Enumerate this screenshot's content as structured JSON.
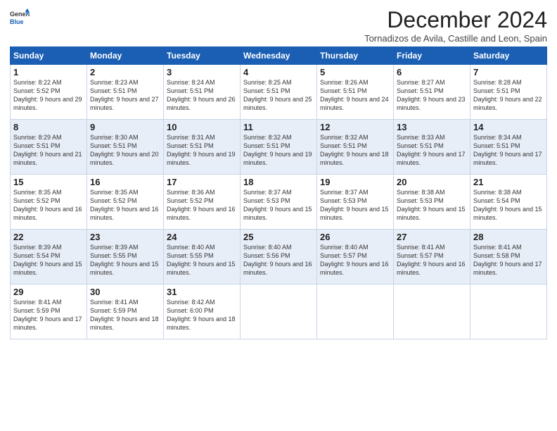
{
  "header": {
    "logo_general": "General",
    "logo_blue": "Blue",
    "title": "December 2024",
    "location": "Tornadizos de Avila, Castille and Leon, Spain"
  },
  "days_of_week": [
    "Sunday",
    "Monday",
    "Tuesday",
    "Wednesday",
    "Thursday",
    "Friday",
    "Saturday"
  ],
  "weeks": [
    [
      {
        "day": "1",
        "sunrise": "8:22 AM",
        "sunset": "5:52 PM",
        "daylight": "9 hours and 29 minutes."
      },
      {
        "day": "2",
        "sunrise": "8:23 AM",
        "sunset": "5:51 PM",
        "daylight": "9 hours and 27 minutes."
      },
      {
        "day": "3",
        "sunrise": "8:24 AM",
        "sunset": "5:51 PM",
        "daylight": "9 hours and 26 minutes."
      },
      {
        "day": "4",
        "sunrise": "8:25 AM",
        "sunset": "5:51 PM",
        "daylight": "9 hours and 25 minutes."
      },
      {
        "day": "5",
        "sunrise": "8:26 AM",
        "sunset": "5:51 PM",
        "daylight": "9 hours and 24 minutes."
      },
      {
        "day": "6",
        "sunrise": "8:27 AM",
        "sunset": "5:51 PM",
        "daylight": "9 hours and 23 minutes."
      },
      {
        "day": "7",
        "sunrise": "8:28 AM",
        "sunset": "5:51 PM",
        "daylight": "9 hours and 22 minutes."
      }
    ],
    [
      {
        "day": "8",
        "sunrise": "8:29 AM",
        "sunset": "5:51 PM",
        "daylight": "9 hours and 21 minutes."
      },
      {
        "day": "9",
        "sunrise": "8:30 AM",
        "sunset": "5:51 PM",
        "daylight": "9 hours and 20 minutes."
      },
      {
        "day": "10",
        "sunrise": "8:31 AM",
        "sunset": "5:51 PM",
        "daylight": "9 hours and 19 minutes."
      },
      {
        "day": "11",
        "sunrise": "8:32 AM",
        "sunset": "5:51 PM",
        "daylight": "9 hours and 19 minutes."
      },
      {
        "day": "12",
        "sunrise": "8:32 AM",
        "sunset": "5:51 PM",
        "daylight": "9 hours and 18 minutes."
      },
      {
        "day": "13",
        "sunrise": "8:33 AM",
        "sunset": "5:51 PM",
        "daylight": "9 hours and 17 minutes."
      },
      {
        "day": "14",
        "sunrise": "8:34 AM",
        "sunset": "5:51 PM",
        "daylight": "9 hours and 17 minutes."
      }
    ],
    [
      {
        "day": "15",
        "sunrise": "8:35 AM",
        "sunset": "5:52 PM",
        "daylight": "9 hours and 16 minutes."
      },
      {
        "day": "16",
        "sunrise": "8:35 AM",
        "sunset": "5:52 PM",
        "daylight": "9 hours and 16 minutes."
      },
      {
        "day": "17",
        "sunrise": "8:36 AM",
        "sunset": "5:52 PM",
        "daylight": "9 hours and 16 minutes."
      },
      {
        "day": "18",
        "sunrise": "8:37 AM",
        "sunset": "5:53 PM",
        "daylight": "9 hours and 15 minutes."
      },
      {
        "day": "19",
        "sunrise": "8:37 AM",
        "sunset": "5:53 PM",
        "daylight": "9 hours and 15 minutes."
      },
      {
        "day": "20",
        "sunrise": "8:38 AM",
        "sunset": "5:53 PM",
        "daylight": "9 hours and 15 minutes."
      },
      {
        "day": "21",
        "sunrise": "8:38 AM",
        "sunset": "5:54 PM",
        "daylight": "9 hours and 15 minutes."
      }
    ],
    [
      {
        "day": "22",
        "sunrise": "8:39 AM",
        "sunset": "5:54 PM",
        "daylight": "9 hours and 15 minutes."
      },
      {
        "day": "23",
        "sunrise": "8:39 AM",
        "sunset": "5:55 PM",
        "daylight": "9 hours and 15 minutes."
      },
      {
        "day": "24",
        "sunrise": "8:40 AM",
        "sunset": "5:55 PM",
        "daylight": "9 hours and 15 minutes."
      },
      {
        "day": "25",
        "sunrise": "8:40 AM",
        "sunset": "5:56 PM",
        "daylight": "9 hours and 16 minutes."
      },
      {
        "day": "26",
        "sunrise": "8:40 AM",
        "sunset": "5:57 PM",
        "daylight": "9 hours and 16 minutes."
      },
      {
        "day": "27",
        "sunrise": "8:41 AM",
        "sunset": "5:57 PM",
        "daylight": "9 hours and 16 minutes."
      },
      {
        "day": "28",
        "sunrise": "8:41 AM",
        "sunset": "5:58 PM",
        "daylight": "9 hours and 17 minutes."
      }
    ],
    [
      {
        "day": "29",
        "sunrise": "8:41 AM",
        "sunset": "5:59 PM",
        "daylight": "9 hours and 17 minutes."
      },
      {
        "day": "30",
        "sunrise": "8:41 AM",
        "sunset": "5:59 PM",
        "daylight": "9 hours and 18 minutes."
      },
      {
        "day": "31",
        "sunrise": "8:42 AM",
        "sunset": "6:00 PM",
        "daylight": "9 hours and 18 minutes."
      },
      null,
      null,
      null,
      null
    ]
  ]
}
